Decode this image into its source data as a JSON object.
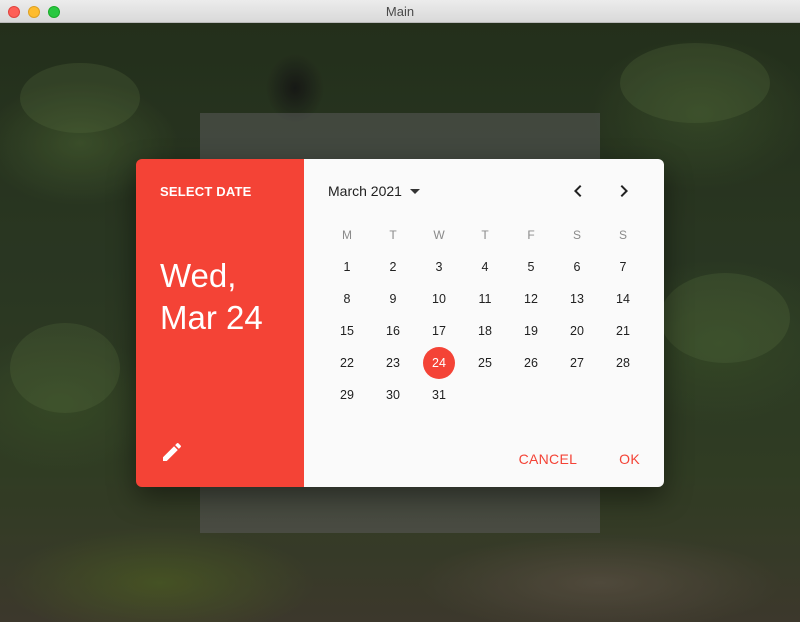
{
  "window": {
    "title": "Main"
  },
  "dialog": {
    "header_label": "SELECT DATE",
    "selected_weekday_line": "Wed,",
    "selected_date_line": "Mar 24",
    "month_label": "March 2021",
    "weekdays": [
      "M",
      "T",
      "W",
      "T",
      "F",
      "S",
      "S"
    ],
    "weeks": [
      [
        "1",
        "2",
        "3",
        "4",
        "5",
        "6",
        "7"
      ],
      [
        "8",
        "9",
        "10",
        "11",
        "12",
        "13",
        "14"
      ],
      [
        "15",
        "16",
        "17",
        "18",
        "19",
        "20",
        "21"
      ],
      [
        "22",
        "23",
        "24",
        "25",
        "26",
        "27",
        "28"
      ],
      [
        "29",
        "30",
        "31",
        "",
        "",
        "",
        ""
      ]
    ],
    "selected_day": "24",
    "cancel_label": "CANCEL",
    "ok_label": "OK",
    "icons": {
      "edit": "pencil-icon",
      "prev": "chevron-left-icon",
      "next": "chevron-right-icon",
      "month_dropdown": "caret-down-icon"
    },
    "colors": {
      "accent": "#f44336",
      "surface": "#fafafa"
    }
  }
}
